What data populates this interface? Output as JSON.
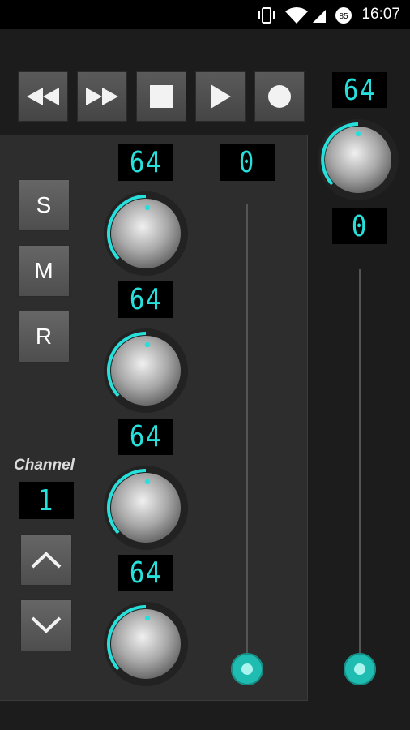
{
  "status_bar": {
    "time": "16:07",
    "battery_level": "85"
  },
  "transport": {
    "buttons": [
      {
        "name": "rewind",
        "icon": "rewind-icon"
      },
      {
        "name": "fast-forward",
        "icon": "fast-forward-icon"
      },
      {
        "name": "stop",
        "icon": "stop-icon"
      },
      {
        "name": "play",
        "icon": "play-icon"
      },
      {
        "name": "record",
        "icon": "record-icon"
      }
    ]
  },
  "master": {
    "knob_display": "64",
    "fader_display": "0"
  },
  "channel_strip": {
    "knob_displays": [
      "64",
      "64",
      "64",
      "64"
    ],
    "fader_display": "0",
    "buttons": {
      "solo": "S",
      "mute": "M",
      "record": "R"
    },
    "channel_label": "Channel",
    "channel_number": "1"
  },
  "colors": {
    "accent": "#27e0dc",
    "background": "#1c1c1c",
    "panel": "#2d2d2d"
  }
}
